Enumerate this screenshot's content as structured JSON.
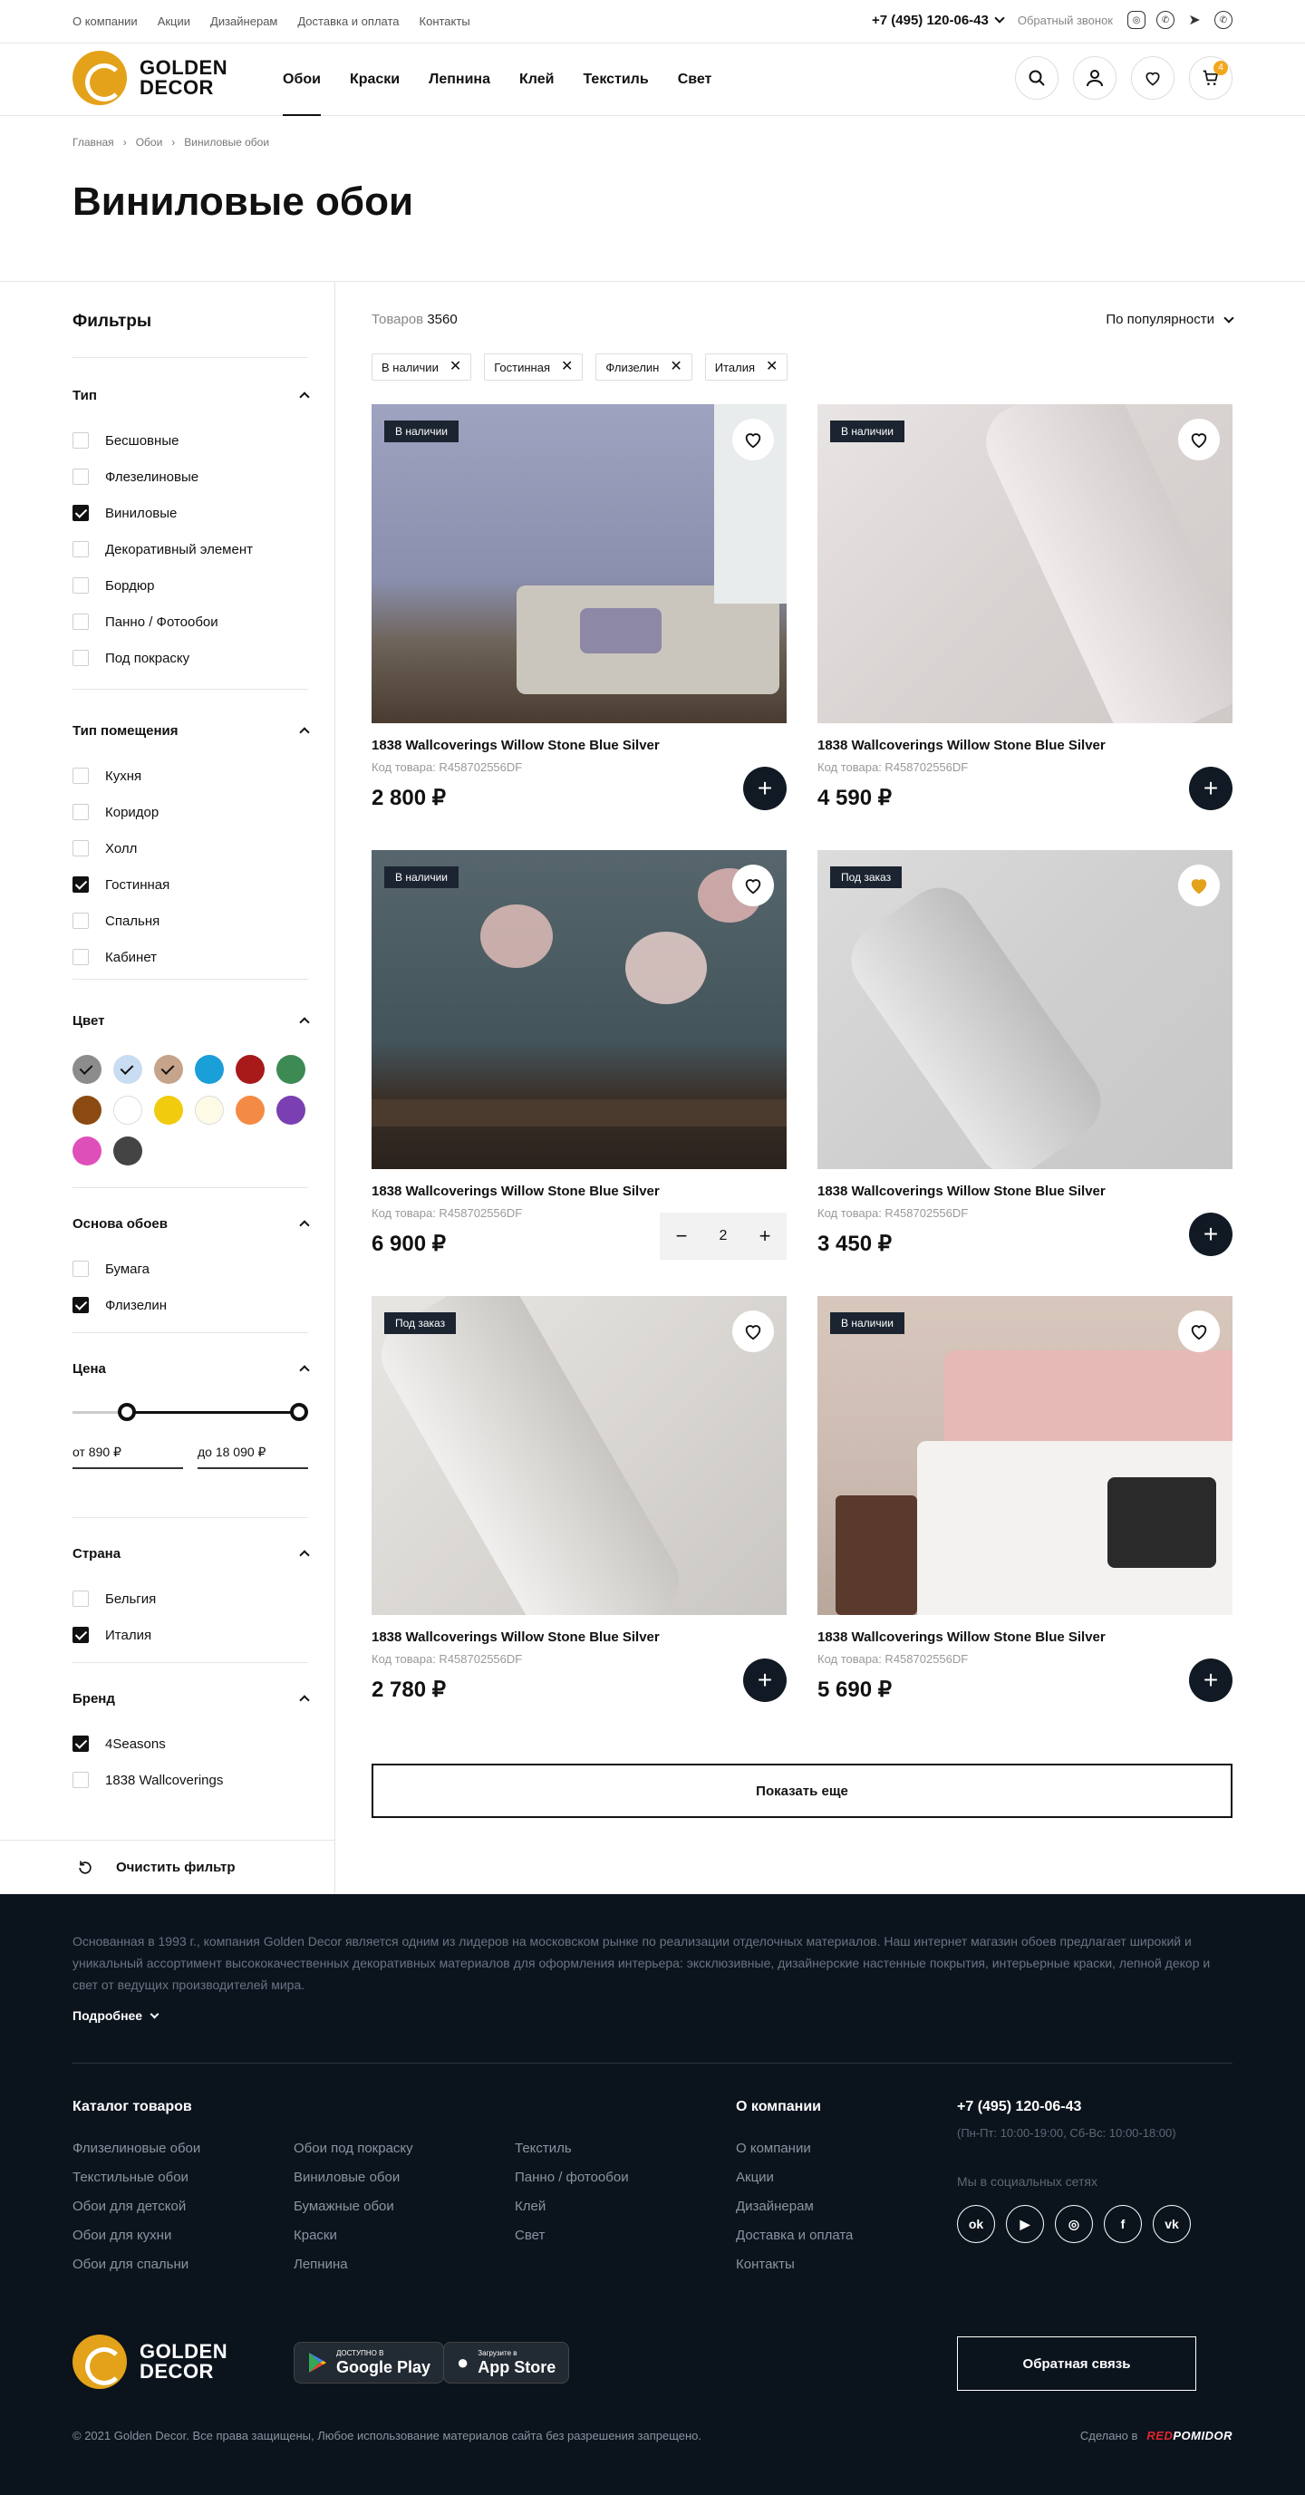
{
  "topbar": {
    "links": [
      "О компании",
      "Акции",
      "Дизайнерам",
      "Доставка и оплата",
      "Контакты"
    ],
    "phone": "+7 (495) 120-06-43",
    "callback": "Обратный звонок"
  },
  "logo": {
    "line1": "GOLDEN",
    "line2": "DECOR"
  },
  "nav": [
    "Обои",
    "Краски",
    "Лепнина",
    "Клей",
    "Текстиль",
    "Свет"
  ],
  "cart_count": "4",
  "breadcrumbs": [
    "Главная",
    "Обои",
    "Виниловые обои"
  ],
  "page_title": "Виниловые обои",
  "filters": {
    "title": "Фильтры",
    "type": {
      "title": "Тип",
      "options": [
        {
          "label": "Бесшовные",
          "checked": false
        },
        {
          "label": "Флезелиновые",
          "checked": false
        },
        {
          "label": "Виниловые",
          "checked": true
        },
        {
          "label": "Декоративный элемент",
          "checked": false
        },
        {
          "label": "Бордюр",
          "checked": false
        },
        {
          "label": "Панно / Фотообои",
          "checked": false
        },
        {
          "label": "Под покраску",
          "checked": false
        }
      ]
    },
    "room": {
      "title": "Тип помещения",
      "options": [
        {
          "label": "Кухня",
          "checked": false
        },
        {
          "label": "Коридор",
          "checked": false
        },
        {
          "label": "Холл",
          "checked": false
        },
        {
          "label": "Гостинная",
          "checked": true
        },
        {
          "label": "Спальня",
          "checked": false
        },
        {
          "label": "Кабинет",
          "checked": false
        }
      ]
    },
    "color": {
      "title": "Цвет",
      "swatches": [
        {
          "color": "#8c8c8c",
          "selected": true
        },
        {
          "color": "#c9ddf2",
          "selected": true
        },
        {
          "color": "#c6a38b",
          "selected": true
        },
        {
          "color": "#1a9fd8",
          "selected": false
        },
        {
          "color": "#a8191a",
          "selected": false
        },
        {
          "color": "#3d8a55",
          "selected": false
        },
        {
          "color": "#8b4a12",
          "selected": false
        },
        {
          "color": "#ffffff",
          "selected": false
        },
        {
          "color": "#f1cb0e",
          "selected": false
        },
        {
          "color": "#fdfbe6",
          "selected": false
        },
        {
          "color": "#f48b45",
          "selected": false
        },
        {
          "color": "#7a3fb3",
          "selected": false
        },
        {
          "color": "#df4fb9",
          "selected": false
        },
        {
          "color": "#444444",
          "selected": false
        }
      ]
    },
    "base": {
      "title": "Основа обоев",
      "options": [
        {
          "label": "Бумага",
          "checked": false
        },
        {
          "label": "Флизелин",
          "checked": true
        }
      ]
    },
    "price": {
      "title": "Цена",
      "from": "от 890 ₽",
      "to": "до 18 090 ₽"
    },
    "country": {
      "title": "Страна",
      "options": [
        {
          "label": "Бельгия",
          "checked": false
        },
        {
          "label": "Италия",
          "checked": true
        }
      ]
    },
    "brand": {
      "title": "Бренд",
      "options": [
        {
          "label": "4Seasons",
          "checked": true
        },
        {
          "label": "1838 Wallcoverings",
          "checked": false
        }
      ]
    },
    "clear": "Очистить фильтр"
  },
  "listing": {
    "count_label": "Товаров",
    "count": "3560",
    "sort": "По популярности",
    "chips": [
      "В наличии",
      "Гостинная",
      "Флизелин",
      "Италия"
    ],
    "show_more": "Показать еще"
  },
  "products": [
    {
      "badge": "В наличии",
      "name": "1838 Wallcoverings Willow Stone Blue Silver",
      "code": "Код товара: R458702556DF",
      "price": "2 800 ₽",
      "fav": false,
      "qty": null
    },
    {
      "badge": "В наличии",
      "name": "1838 Wallcoverings Willow Stone Blue Silver",
      "code": "Код товара: R458702556DF",
      "price": "4 590 ₽",
      "fav": false,
      "qty": null
    },
    {
      "badge": "В наличии",
      "name": "1838 Wallcoverings Willow Stone Blue Silver",
      "code": "Код товара: R458702556DF",
      "price": "6 900 ₽",
      "fav": false,
      "qty": "2"
    },
    {
      "badge": "Под заказ",
      "name": "1838 Wallcoverings Willow Stone Blue Silver",
      "code": "Код товара: R458702556DF",
      "price": "3 450 ₽",
      "fav": true,
      "qty": null
    },
    {
      "badge": "Под заказ",
      "name": "1838 Wallcoverings Willow Stone Blue Silver",
      "code": "Код товара: R458702556DF",
      "price": "2 780 ₽",
      "fav": false,
      "qty": null
    },
    {
      "badge": "В наличии",
      "name": "1838 Wallcoverings Willow Stone Blue Silver",
      "code": "Код товара: R458702556DF",
      "price": "5 690 ₽",
      "fav": false,
      "qty": null
    }
  ],
  "footer": {
    "about": "Основанная в 1993 г., компания Golden Decor является одним из лидеров на московском рынке по реализации отделочных материалов. Наш интернет магазин обоев предлагает широкий и уникальный ассортимент высококачественных декоративных материалов для оформления интерьера: эксклюзивные, дизайнерские настенные покрытия, интерьерные краски, лепной декор и свет от ведущих производителей мира.",
    "more": "Подробнее",
    "catalog_title": "Каталог товаров",
    "catalog_col1": [
      "Флизелиновые обои",
      "Текстильные обои",
      "Обои для детской",
      "Обои для кухни",
      "Обои для спальни"
    ],
    "catalog_col2": [
      "Обои под покраску",
      "Виниловые обои",
      "Бумажные обои",
      "Краски",
      "Лепнина"
    ],
    "catalog_col3": [
      "Текстиль",
      "Панно / фотообои",
      "Клей",
      "Свет"
    ],
    "company_title": "О компании",
    "company_links": [
      "О компании",
      "Акции",
      "Дизайнерам",
      "Доставка и оплата",
      "Контакты"
    ],
    "phone": "+7 (495) 120-06-43",
    "hours": "(Пн-Пт: 10:00-19:00, Сб-Вс: 10:00-18:00)",
    "social_title": "Мы в социальных сетях",
    "google_small": "ДОСТУПНО В",
    "google_big": "Google Play",
    "apple_small": "Загрузите в",
    "apple_big": "App Store",
    "feedback": "Обратная связь",
    "copyright": "© 2021 Golden Decor. Все права защищены, Любое использование материалов сайта без разрешения запрещено.",
    "made_by": "Сделано в",
    "made_brand_red": "RED",
    "made_brand_white": "POMIDOR"
  },
  "colors": {
    "accent": "#e3a21a",
    "dark": "#0b131d"
  }
}
